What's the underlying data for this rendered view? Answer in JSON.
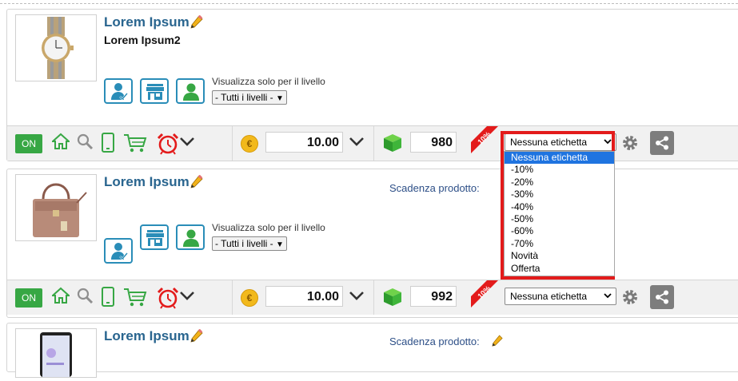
{
  "products": [
    {
      "title": "Lorem Ipsum",
      "subtitle": "Lorem Ipsum2",
      "thumbnail": "watch-image",
      "visibility_label": "Visualizza solo per il livello",
      "level_select": "- Tutti i livelli -",
      "expiry_label": "",
      "toolbar": {
        "on_label": "ON",
        "currency_icon": "€",
        "price": "10.00",
        "quantity": "980",
        "ribbon_text": "10%",
        "tag_select": "Nessuna etichetta"
      }
    },
    {
      "title": "Lorem Ipsum",
      "subtitle": "",
      "thumbnail": "handbag-image",
      "visibility_label": "Visualizza solo per il livello",
      "level_select": "- Tutti i livelli -",
      "expiry_label": "Scadenza prodotto:",
      "toolbar": {
        "on_label": "ON",
        "currency_icon": "€",
        "price": "10.00",
        "quantity": "992",
        "ribbon_text": "10%",
        "tag_select": "Nessuna etichetta"
      }
    },
    {
      "title": "Lorem Ipsum",
      "thumbnail": "phone-image",
      "expiry_label": "Scadenza prodotto:"
    }
  ],
  "tag_dropdown": {
    "selected": "Nessuna etichetta",
    "options": [
      "Nessuna etichetta",
      "-10%",
      "-20%",
      "-30%",
      "-40%",
      "-50%",
      "-60%",
      "-70%",
      "Novità",
      "Offerta"
    ]
  },
  "colors": {
    "title": "#29658f",
    "on_button": "#37a744",
    "highlight": "#e31b1b",
    "selected_option": "#1f74e0",
    "ribbon": "#e31b1b"
  },
  "icons": [
    "pencil-icon",
    "user-check-icon",
    "store-icon",
    "user-icon",
    "home-icon",
    "search-icon",
    "mobile-icon",
    "cart-icon",
    "alarm-clock-icon",
    "chevron-down-icon",
    "coin-icon",
    "cube-icon",
    "gear-icon",
    "share-icon"
  ]
}
